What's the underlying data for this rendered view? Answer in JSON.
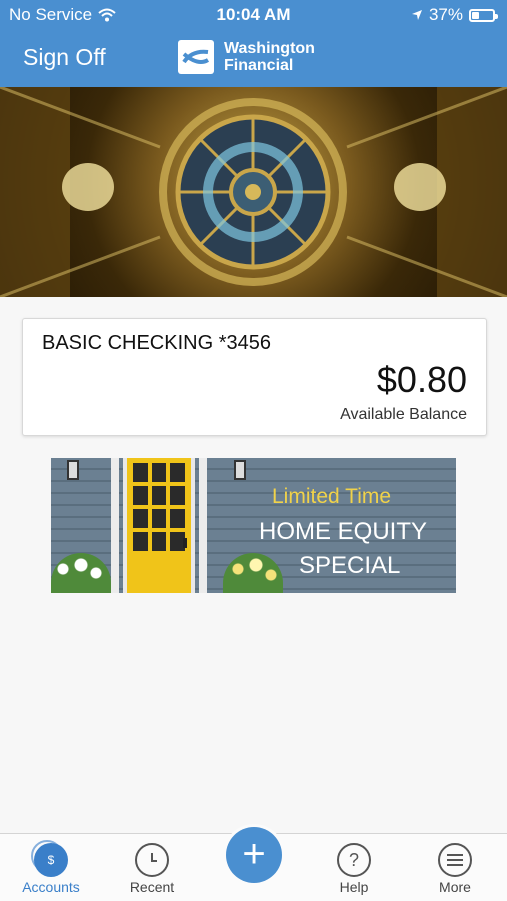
{
  "status": {
    "carrier": "No Service",
    "time": "10:04 AM",
    "battery": "37%",
    "battery_level": 0.37
  },
  "nav": {
    "sign_off": "Sign Off",
    "logo_line1": "Washington",
    "logo_line2": "Financial"
  },
  "account": {
    "name": "BASIC CHECKING *3456",
    "balance": "$0.80",
    "balance_label": "Available Balance"
  },
  "promo": {
    "line1": "Limited Time",
    "line2": "HOME EQUITY",
    "line3": "SPECIAL"
  },
  "tabs": [
    {
      "label": "Accounts",
      "icon": "dollar-icon",
      "glyph": "$"
    },
    {
      "label": "Recent",
      "icon": "clock-icon",
      "glyph": "◷"
    },
    {
      "label": "Help",
      "icon": "help-icon",
      "glyph": "?"
    },
    {
      "label": "More",
      "icon": "menu-icon",
      "glyph": ""
    }
  ],
  "fab": {
    "glyph": "+"
  },
  "colors": {
    "brand": "#4a8fd0",
    "active_tab": "#3a7fc9",
    "promo_title": "#f0d24a"
  }
}
